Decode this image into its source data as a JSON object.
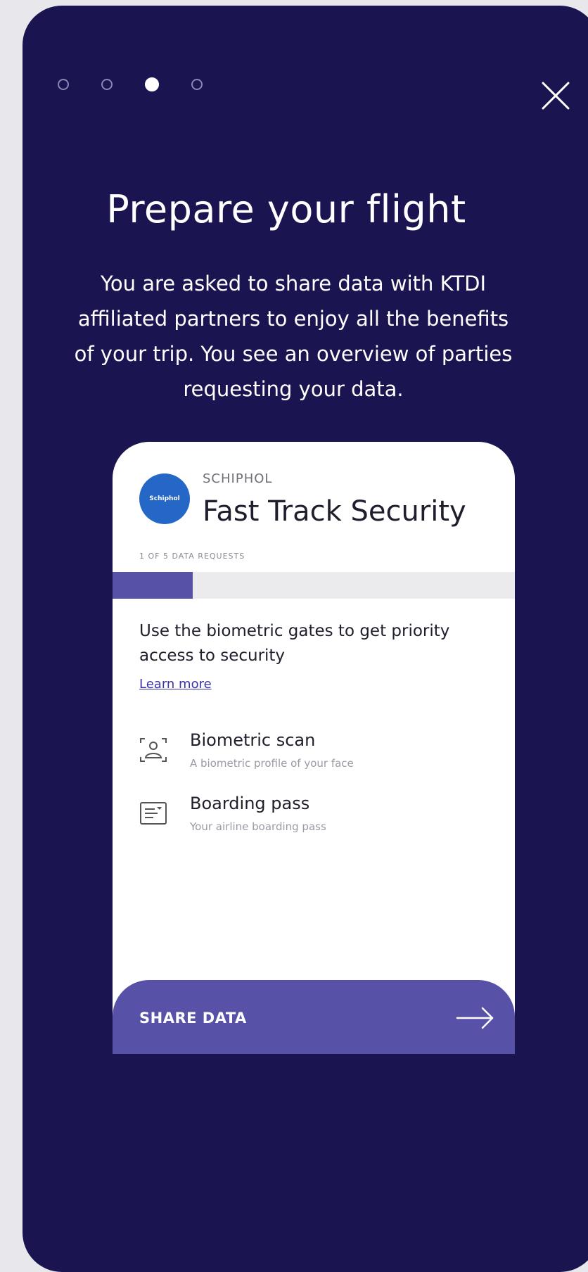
{
  "pagination": {
    "total": 4,
    "active_index": 2
  },
  "header": {
    "title": "Prepare your flight",
    "description": "You are asked to share data with KTDI affiliated partners to enjoy all the benefits of your trip. You see an overview of parties requesting your data."
  },
  "card": {
    "logo_text": "Schiphol",
    "org_name": "SCHIPHOL",
    "title": "Fast Track Security",
    "request_counter": "1 OF 5 DATA REQUESTS",
    "progress": 0.2,
    "description": "Use the biometric gates to get priority access to security",
    "learn_more": "Learn more",
    "items": [
      {
        "icon": "biometric-scan-icon",
        "title": "Biometric scan",
        "subtitle": "A biometric profile of your face"
      },
      {
        "icon": "boarding-pass-icon",
        "title": "Boarding pass",
        "subtitle": "Your airline boarding pass"
      }
    ],
    "share_label": "SHARE DATA"
  },
  "colors": {
    "background": "#1a1451",
    "accent": "#5751a7",
    "logo": "#2567c6"
  }
}
